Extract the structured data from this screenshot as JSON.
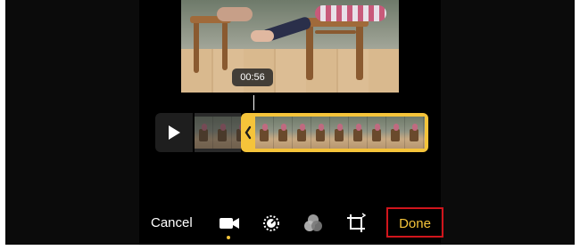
{
  "video": {
    "timecode": "00:56"
  },
  "toolbar": {
    "cancel_label": "Cancel",
    "done_label": "Done",
    "tools": [
      "video-camera-icon",
      "adjust-dial-icon",
      "filters-icon",
      "crop-rotate-icon"
    ],
    "active_tool": "video-camera-icon"
  },
  "timeline": {
    "play_icon": "play-icon"
  },
  "colors": {
    "accent": "#f5c43a",
    "highlight_box": "#d0151c",
    "background": "#000000"
  }
}
